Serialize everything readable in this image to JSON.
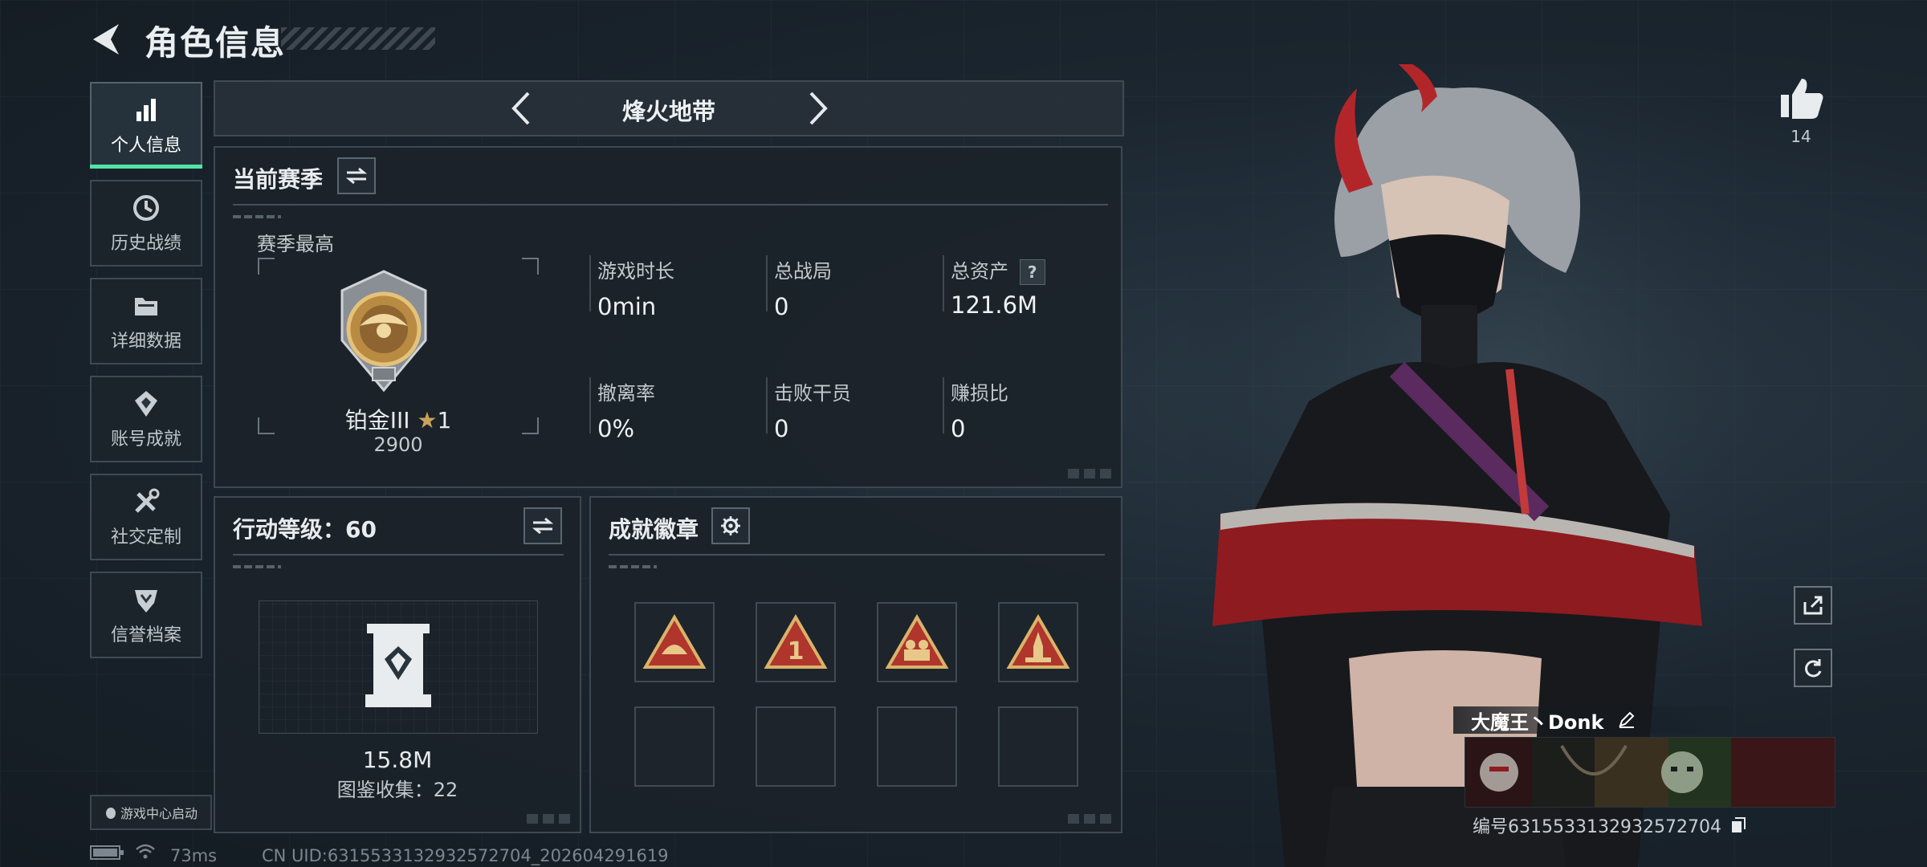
{
  "header": {
    "title": "角色信息"
  },
  "nav": {
    "items": [
      {
        "label": "个人信息",
        "icon": "bar-chart-icon",
        "active": true
      },
      {
        "label": "历史战绩",
        "icon": "history-icon"
      },
      {
        "label": "详细数据",
        "icon": "folder-icon"
      },
      {
        "label": "账号成就",
        "icon": "achievement-icon"
      },
      {
        "label": "社交定制",
        "icon": "tools-icon"
      },
      {
        "label": "信誉档案",
        "icon": "shield-icon"
      }
    ]
  },
  "map": {
    "name": "烽火地带"
  },
  "season": {
    "title": "当前赛季",
    "best_label": "赛季最高",
    "rank": "铂金III",
    "star_count": "1",
    "score": "2900",
    "stats": [
      {
        "label": "游戏时长",
        "value": "0min"
      },
      {
        "label": "总战局",
        "value": "0"
      },
      {
        "label": "总资产",
        "value": "121.6M",
        "help": "?"
      },
      {
        "label": "撤离率",
        "value": "0%"
      },
      {
        "label": "击败干员",
        "value": "0"
      },
      {
        "label": "赚损比",
        "value": "0"
      }
    ]
  },
  "action_level": {
    "title": "行动等级：60",
    "value": "15.8M",
    "collection": "图鉴收集：22"
  },
  "badges": {
    "title": "成就徽章",
    "filled_count": 4,
    "slot_count": 8
  },
  "player": {
    "likes": "14",
    "name": "大魔王丶Donk",
    "id_text": "编号6315533132932572704"
  },
  "launch": {
    "label": "游戏中心启动"
  },
  "footer": {
    "ping": "73ms",
    "uid": "CN UID:6315533132932572704_202604291619"
  },
  "colors": {
    "accent": "#53e2a6",
    "gold": "#c9a25a",
    "badge_red": "#b0352c"
  }
}
